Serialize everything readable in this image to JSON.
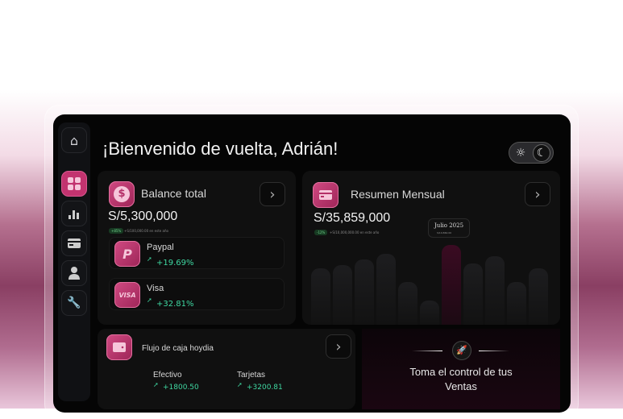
{
  "header": {
    "title": "¡Bienvenido de vuelta, Adrián!"
  },
  "sidebar": {
    "items": [
      "home",
      "dashboard",
      "reports",
      "cards",
      "profile",
      "settings"
    ],
    "active": "dashboard"
  },
  "balance": {
    "title": "Balance total",
    "amount": "S/5,300,000",
    "badge": "+85%",
    "note": "+S/100,000.00 en este año",
    "accounts": [
      {
        "name": "Paypal",
        "change": "+19.69%"
      },
      {
        "name": "Visa",
        "logo": "VISA",
        "change": "+32.81%"
      }
    ]
  },
  "monthly": {
    "title": "Resumen Mensual",
    "amount": "S/35,859,000",
    "badge": "-12%",
    "note": "+S/10,000,000.00 en este año",
    "tooltip": {
      "title": "Julio 2025",
      "value": "S/10,860.00"
    }
  },
  "chart_data": {
    "type": "bar",
    "values": [
      70,
      74,
      81,
      88,
      53,
      30,
      99,
      76,
      85,
      53,
      70
    ],
    "highlight_index": 6,
    "ylim": [
      0,
      100
    ]
  },
  "cashflow": {
    "title": "Flujo de caja hoydia",
    "items": [
      {
        "label": "Efectivo",
        "value": "+1800.50"
      },
      {
        "label": "Tarjetas",
        "value": "+3200.81"
      }
    ]
  },
  "promo": {
    "line1": "Toma el control de tus",
    "line2": "Ventas"
  },
  "colors": {
    "accent": "#c2336f",
    "positive": "#3fd8a2"
  }
}
